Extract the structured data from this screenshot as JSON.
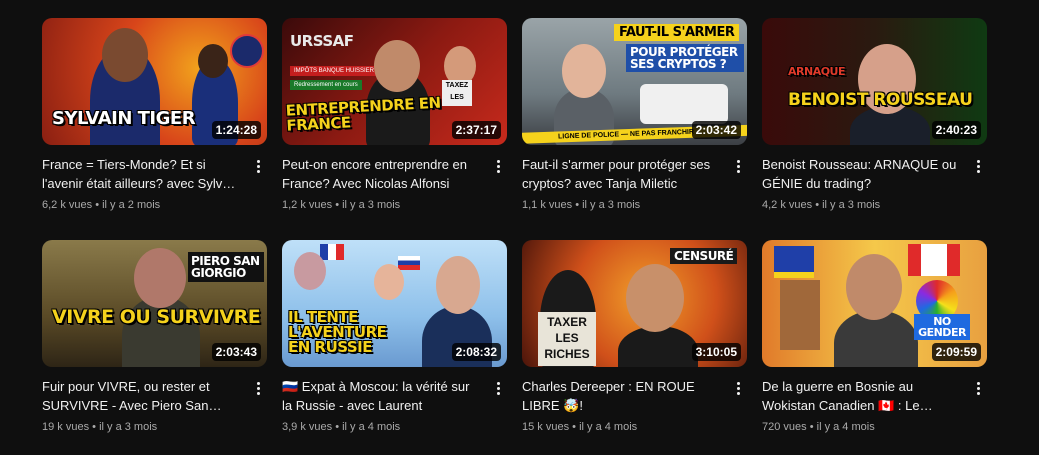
{
  "videos": [
    {
      "thumb_text": "SYLVAIN TIGER",
      "duration": "1:24:28",
      "title": "France = Tiers-Monde? Et si l'avenir était ailleurs? avec Sylvain TIGER",
      "views": "6,2 k vues",
      "age": "il y a 2 mois",
      "palette": [
        "#c0381a",
        "#f2a31c",
        "#1b2a6b"
      ]
    },
    {
      "thumb_text": "ENTREPRENDRE EN FRANCE",
      "thumb_top_text": "URSSAF",
      "thumb_tags": [
        "IMPÔTS BANQUE HUISSIER",
        "Redressement en cours"
      ],
      "thumb_sign": "TAXEZ LES",
      "duration": "2:37:17",
      "title": "Peut-on encore entreprendre en France? Avec Nicolas Alfonsi",
      "views": "1,2 k vues",
      "age": "il y a 3 mois",
      "palette": [
        "#5a0f0f",
        "#c72a1c",
        "#2a1a12"
      ]
    },
    {
      "thumb_text": "FAUT-IL S'ARMER",
      "thumb_sub_text": "POUR PROTÉGER SES CRYPTOS ?",
      "thumb_tape": "LIGNE DE POLICE — NE PAS FRANCHIR",
      "duration": "2:03:42",
      "title": "Faut-il s'armer pour protéger ses cryptos? avec Tanja Miletic",
      "views": "1,1 k vues",
      "age": "il y a 3 mois",
      "palette": [
        "#7d8a8f",
        "#e9c31f",
        "#3c3f44"
      ]
    },
    {
      "thumb_text": "BENOIST ROUSSEAU",
      "thumb_top_text": "ARNAQUE",
      "duration": "2:40:23",
      "title": "Benoist Rousseau: ARNAQUE ou GÉNIE du trading?",
      "views": "4,2 k vues",
      "age": "il y a 3 mois",
      "palette": [
        "#3a0a0a",
        "#1e7a1e",
        "#f2c81c"
      ]
    },
    {
      "thumb_text": "VIVRE OU SURVIVRE",
      "thumb_top_text": "PIERO SAN GIORGIO",
      "duration": "2:03:43",
      "title": "Fuir pour VIVRE, ou rester et SURVIVRE - Avec Piero San Giorgio",
      "views": "19 k vues",
      "age": "il y a 3 mois",
      "palette": [
        "#6b5a2a",
        "#a88a3a",
        "#2e2516"
      ]
    },
    {
      "thumb_text": "IL TENTE L'AVENTURE EN RUSSIE",
      "duration": "2:08:32",
      "title": "🇷🇺 Expat à Moscou: la vérité sur la Russie - avec Laurent",
      "views": "3,9 k vues",
      "age": "il y a 4 mois",
      "palette": [
        "#9ec9f0",
        "#1a3c8c",
        "#d8d0c6"
      ]
    },
    {
      "thumb_text": "TAXER LES RICHES",
      "thumb_top_text": "CENSURÉ",
      "duration": "3:10:05",
      "title": "Charles Dereeper : EN ROUE LIBRE 🤯!",
      "views": "15 k vues",
      "age": "il y a 4 mois",
      "palette": [
        "#d9531a",
        "#f29a2a",
        "#1a1a1a"
      ]
    },
    {
      "thumb_text": "NO GENDER",
      "duration": "2:09:59",
      "title": "De la guerre en Bosnie au Wokistan Canadien 🇨🇦 : Le parcours de Filip...",
      "views": "720 vues",
      "age": "il y a 4 mois",
      "palette": [
        "#e08a2a",
        "#f5c84a",
        "#5a3a1a"
      ]
    }
  ]
}
